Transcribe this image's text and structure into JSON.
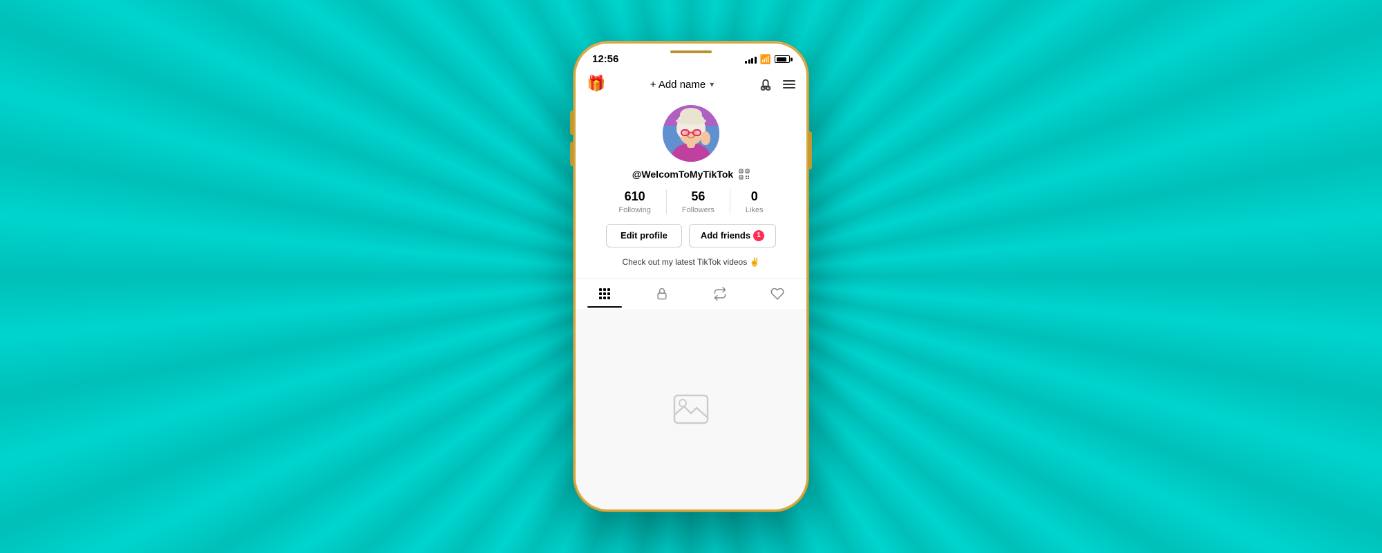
{
  "background": {
    "color": "#00c8be"
  },
  "phone": {
    "frame_color": "#d4a843"
  },
  "status_bar": {
    "time": "12:56",
    "signal_bars": [
      3,
      5,
      7,
      9,
      11
    ],
    "battery_percent": 85
  },
  "header": {
    "gift_icon": "🎁",
    "add_name_label": "+ Add name",
    "chevron": "▾",
    "qr_label": "QR"
  },
  "profile": {
    "username": "@WelcomToMyTikTok",
    "username_display": "@WelcomToMyTikTok",
    "stats": [
      {
        "number": "610",
        "label": "Following"
      },
      {
        "number": "56",
        "label": "Followers"
      },
      {
        "number": "0",
        "label": "Likes"
      }
    ],
    "edit_profile_label": "Edit profile",
    "add_friends_label": "Add friends",
    "add_friends_badge": "1",
    "bio": "Check out my latest TikTok videos ✌️"
  },
  "tabs": [
    {
      "id": "grid",
      "label": "Grid",
      "active": true
    },
    {
      "id": "lock",
      "label": "Locked",
      "active": false
    },
    {
      "id": "repost",
      "label": "Repost",
      "active": false
    },
    {
      "id": "liked",
      "label": "Liked",
      "active": false
    }
  ],
  "content": {
    "empty_state_icon": "image"
  }
}
